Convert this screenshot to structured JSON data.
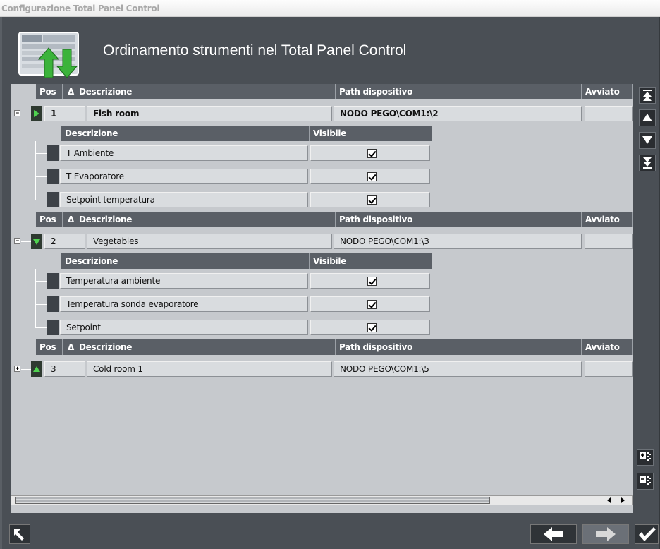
{
  "window": {
    "title": "Configurazione Total Panel Control"
  },
  "header": {
    "title": "Ordinamento strumenti nel Total Panel Control"
  },
  "columns": {
    "pos": "Pos",
    "sort_indicator": "Δ",
    "descrizione": "Descrizione",
    "path": "Path dispositivo",
    "avviato": "Avviato"
  },
  "sub_columns": {
    "descrizione": "Descrizione",
    "visibile": "Visibile"
  },
  "devices": [
    {
      "pos": "1",
      "descrizione": "Fish room",
      "path": "NODO PEGO\\COM1:\\2",
      "avviato": "",
      "expanded": true,
      "items": [
        {
          "descrizione": "T Ambiente",
          "visibile": true
        },
        {
          "descrizione": "T Evaporatore",
          "visibile": true
        },
        {
          "descrizione": "Setpoint temperatura",
          "visibile": true
        }
      ]
    },
    {
      "pos": "2",
      "descrizione": "Vegetables",
      "path": "NODO PEGO\\COM1:\\3",
      "avviato": "",
      "expanded": true,
      "items": [
        {
          "descrizione": "Temperatura ambiente",
          "visibile": true
        },
        {
          "descrizione": "Temperatura sonda evaporatore",
          "visibile": true
        },
        {
          "descrizione": "Setpoint",
          "visibile": true
        }
      ]
    },
    {
      "pos": "3",
      "descrizione": "Cold room 1",
      "path": "NODO PEGO\\COM1:\\5",
      "avviato": "",
      "expanded": false,
      "items": []
    }
  ],
  "tree_symbols": {
    "expanded": "−",
    "collapsed": "+"
  },
  "right_toolbar": [
    "move-top-icon",
    "move-up-icon",
    "move-down-icon",
    "move-bottom-icon",
    "expand-all-icon",
    "collapse-all-icon"
  ],
  "bottom_toolbar": [
    "back-icon",
    "previous-icon",
    "next-icon",
    "confirm-icon"
  ],
  "colors": {
    "status_green": "#4fd34f",
    "header_bg": "#5a5f66",
    "panel_bg": "#c6c9cd",
    "frame_bg": "#4a4f55"
  }
}
